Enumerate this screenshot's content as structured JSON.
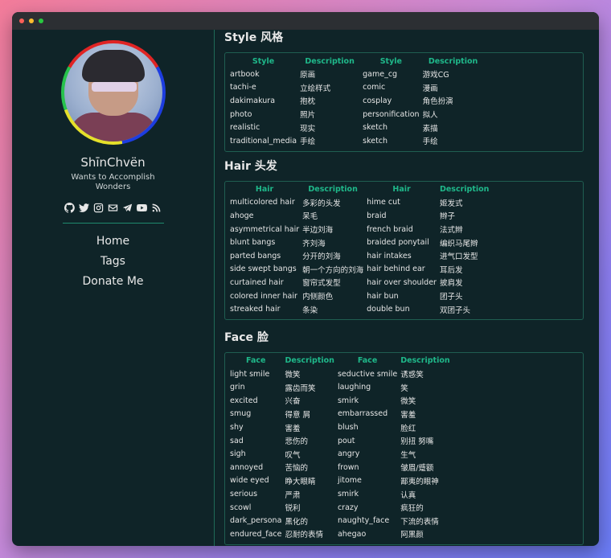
{
  "window": {
    "controls": [
      "close",
      "minimize",
      "maximize"
    ]
  },
  "sidebar": {
    "site_name": "ShīnChvën",
    "subtitle": "Wants to Accomplish Wonders",
    "social_icons": [
      "github-icon",
      "twitter-icon",
      "instagram-icon",
      "email-icon",
      "telegram-icon",
      "youtube-icon",
      "rss-icon"
    ],
    "nav": [
      "Home",
      "Tags",
      "Donate Me"
    ]
  },
  "sections": {
    "style": {
      "title": "Style 风格",
      "headers": [
        "Style",
        "Description",
        "Style",
        "Description"
      ],
      "rows": [
        [
          "artbook",
          "原画",
          "game_cg",
          "游戏CG"
        ],
        [
          "tachi-e",
          "立绘样式",
          "comic",
          "漫画"
        ],
        [
          "dakimakura",
          "抱枕",
          "cosplay",
          "角色扮演"
        ],
        [
          "photo",
          "照片",
          "personification",
          "拟人"
        ],
        [
          "realistic",
          "现实",
          "sketch",
          "素描"
        ],
        [
          "traditional_media",
          "手绘",
          "sketch",
          "手绘"
        ]
      ]
    },
    "hair": {
      "title": "Hair 头发",
      "headers": [
        "Hair",
        "Description",
        "Hair",
        "Description"
      ],
      "rows": [
        [
          "multicolored hair",
          "多彩的头发",
          "hime cut",
          "姬发式"
        ],
        [
          "ahoge",
          "呆毛",
          "braid",
          "辫子"
        ],
        [
          "asymmetrical hair",
          "半边刘海",
          "french braid",
          "法式辫"
        ],
        [
          "blunt bangs",
          "齐刘海",
          "braided ponytail",
          "编织马尾辫"
        ],
        [
          "parted bangs",
          "分开的刘海",
          "hair intakes",
          "进气口发型"
        ],
        [
          "side swept bangs",
          "朝一个方向的刘海",
          "hair behind ear",
          "耳后发"
        ],
        [
          "curtained hair",
          "窗帘式发型",
          "hair over shoulder",
          "披肩发"
        ],
        [
          "colored inner hair",
          "内侧颜色",
          "hair bun",
          "团子头"
        ],
        [
          "streaked hair",
          "条染",
          "double bun",
          "双团子头"
        ]
      ]
    },
    "face": {
      "title": "Face 脸",
      "headers": [
        "Face",
        "Description",
        "Face",
        "Description"
      ],
      "rows": [
        [
          "light smile",
          "微笑",
          "seductive smile",
          "诱惑笑"
        ],
        [
          "grin",
          "露齿而笑",
          "laughing",
          "笑"
        ],
        [
          "excited",
          "兴奋",
          "smirk",
          "微笑"
        ],
        [
          "smug",
          "得意 屑",
          "embarrassed",
          "害羞"
        ],
        [
          "shy",
          "害羞",
          "blush",
          "脸红"
        ],
        [
          "sad",
          "悲伤的",
          "pout",
          "别扭 努嘴"
        ],
        [
          "sigh",
          "叹气",
          "angry",
          "生气"
        ],
        [
          "annoyed",
          "苦恼的",
          "frown",
          "皱眉/蹙额"
        ],
        [
          "wide eyed",
          "睁大眼睛",
          "jitome",
          "鄙夷的眼神"
        ],
        [
          "serious",
          "严肃",
          "smirk",
          "认真"
        ],
        [
          "scowl",
          "锐利",
          "crazy",
          "疯狂的"
        ],
        [
          "dark_persona",
          "黑化的",
          "naughty_face",
          "下流的表情"
        ],
        [
          "endured_face",
          "忍耐的表情",
          "ahegao",
          "阿黑颜"
        ]
      ]
    }
  }
}
